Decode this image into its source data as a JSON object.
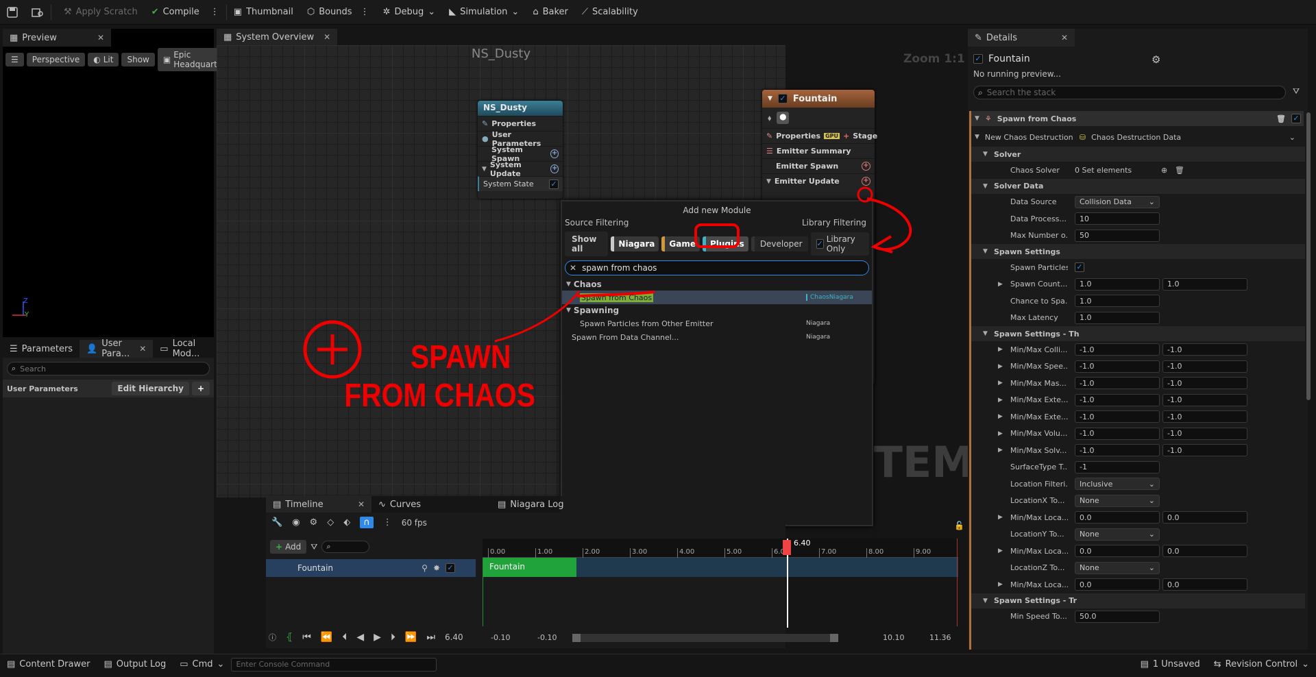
{
  "toolbar": {
    "apply_scratch": "Apply Scratch",
    "compile": "Compile",
    "thumbnail": "Thumbnail",
    "bounds": "Bounds",
    "debug": "Debug",
    "simulation": "Simulation",
    "baker": "Baker",
    "scalability": "Scalability"
  },
  "preview": {
    "tab": "Preview",
    "perspective": "Perspective",
    "lit": "Lit",
    "show": "Show",
    "scene": "Epic Headquarters",
    "axis_z": "Z",
    "axis_y": "Y"
  },
  "params": {
    "tab_parameters": "Parameters",
    "tab_user": "User Para...",
    "tab_local": "Local Mod...",
    "search_placeholder": "Search",
    "user_parameters": "User Parameters",
    "edit_hierarchy": "Edit Hierarchy",
    "add": "+"
  },
  "graph": {
    "tab": "System Overview",
    "title": "NS_Dusty",
    "zoom": "Zoom 1:1",
    "watermark": "STEM"
  },
  "system_node": {
    "title": "NS_Dusty",
    "rows": [
      "Properties",
      "User Parameters",
      "System Spawn",
      "System Update",
      "System State"
    ]
  },
  "emitter_node": {
    "title": "Fountain",
    "properties": "Properties",
    "gpu": "GPU",
    "stage": "Stage",
    "summary": "Emitter Summary",
    "spawn": "Emitter Spawn",
    "update": "Emitter Update"
  },
  "module_menu": {
    "title": "Add new Module",
    "source_filtering": "Source Filtering",
    "library_filtering": "Library Filtering",
    "show_all": "Show all",
    "niagara": "Niagara",
    "game": "Game",
    "plugins": "Plugins",
    "developer": "Developer",
    "library_only": "Library Only",
    "search_value": "spawn from chaos",
    "groups": [
      {
        "name": "Chaos",
        "items": [
          {
            "label": "Spawn from Chaos",
            "source": "ChaosNiagara",
            "selected": true
          }
        ]
      },
      {
        "name": "Spawning",
        "items": [
          {
            "label": "Spawn Particles from Other Emitter",
            "source": "Niagara"
          }
        ]
      }
    ],
    "other": {
      "label": "Spawn From Data Channel...",
      "source": "Niagara"
    }
  },
  "annotation": {
    "line1": "SPAWN",
    "line2": "FROM CHAOS"
  },
  "timeline": {
    "tab_timeline": "Timeline",
    "tab_curves": "Curves",
    "tab_log": "Niagara Log",
    "fps": "60 fps",
    "add": "Add",
    "track": "Fountain",
    "bar_label": "Fountain",
    "playhead": "6.40",
    "time": "6.40",
    "ticks": [
      "0.00",
      "1.00",
      "2.00",
      "3.00",
      "4.00",
      "5.00",
      "6.00",
      "7.00",
      "8.00",
      "9.00"
    ],
    "range_start": "-0.10",
    "range_start2": "-0.10",
    "range_end": "10.10",
    "range_end2": "11.36"
  },
  "status": {
    "content_drawer": "Content Drawer",
    "output_log": "Output Log",
    "cmd": "Cmd",
    "console_placeholder": "Enter Console Command",
    "unsaved": "1 Unsaved",
    "revision": "Revision Control"
  },
  "details": {
    "tab": "Details",
    "emitter": "Fountain",
    "no_preview": "No running preview...",
    "search_placeholder": "Search the stack",
    "module": "Spawn from Chaos",
    "new_chaos": "New Chaos Destruction",
    "chaos_data": "Chaos Destruction Data",
    "rows": [
      {
        "k": "Solver",
        "type": "sect",
        "lvl": 1
      },
      {
        "k": "Chaos Solver",
        "v": "0 Set elements",
        "type": "solver",
        "lvl": 2
      },
      {
        "k": "Solver Data",
        "type": "sect",
        "lvl": 1
      },
      {
        "k": "Data Source",
        "v": "Collision Data",
        "type": "drop",
        "lvl": 2
      },
      {
        "k": "Data Process...",
        "v": "10",
        "lvl": 2
      },
      {
        "k": "Max Number o...",
        "v": "50",
        "lvl": 2
      },
      {
        "k": "Spawn Settings",
        "type": "sect",
        "lvl": 1
      },
      {
        "k": "Spawn Particles",
        "type": "check",
        "lvl": 2
      },
      {
        "k": "Spawn Count...",
        "v": "1.0",
        "v2": "1.0",
        "exp": true,
        "lvl": 2
      },
      {
        "k": "Chance to Spa...",
        "v": "1.0",
        "lvl": 2
      },
      {
        "k": "Max Latency",
        "v": "1.0",
        "lvl": 2
      },
      {
        "k": "Spawn Settings - Th",
        "type": "sect",
        "lvl": 1
      },
      {
        "k": "Min/Max Colli...",
        "v": "-1.0",
        "v2": "-1.0",
        "exp": true,
        "lvl": 2
      },
      {
        "k": "Min/Max Spee...",
        "v": "-1.0",
        "v2": "-1.0",
        "exp": true,
        "lvl": 2
      },
      {
        "k": "Min/Max Mas...",
        "v": "-1.0",
        "v2": "-1.0",
        "exp": true,
        "lvl": 2
      },
      {
        "k": "Min/Max Exte...",
        "v": "-1.0",
        "v2": "-1.0",
        "exp": true,
        "lvl": 2
      },
      {
        "k": "Min/Max Exte...",
        "v": "-1.0",
        "v2": "-1.0",
        "exp": true,
        "lvl": 2
      },
      {
        "k": "Min/Max Volu...",
        "v": "-1.0",
        "v2": "-1.0",
        "exp": true,
        "lvl": 2
      },
      {
        "k": "Min/Max Solv...",
        "v": "-1.0",
        "v2": "-1.0",
        "exp": true,
        "lvl": 2
      },
      {
        "k": "SurfaceType T...",
        "v": "-1",
        "lvl": 2
      },
      {
        "k": "Location Filteri...",
        "v": "Inclusive",
        "type": "drop",
        "lvl": 2
      },
      {
        "k": "LocationX To...",
        "v": "None",
        "type": "drop",
        "lvl": 2
      },
      {
        "k": "Min/Max Loca...",
        "v": "0.0",
        "v2": "0.0",
        "exp": true,
        "lvl": 2
      },
      {
        "k": "LocationY To...",
        "v": "None",
        "type": "drop",
        "lvl": 2
      },
      {
        "k": "Min/Max Loca...",
        "v": "0.0",
        "v2": "0.0",
        "exp": true,
        "lvl": 2
      },
      {
        "k": "LocationZ To...",
        "v": "None",
        "type": "drop",
        "lvl": 2
      },
      {
        "k": "Min/Max Loca...",
        "v": "0.0",
        "v2": "0.0",
        "exp": true,
        "lvl": 2
      },
      {
        "k": "Spawn Settings - Tr",
        "type": "sect",
        "lvl": 1
      },
      {
        "k": "Min Speed To...",
        "v": "50.0",
        "lvl": 2
      }
    ]
  }
}
